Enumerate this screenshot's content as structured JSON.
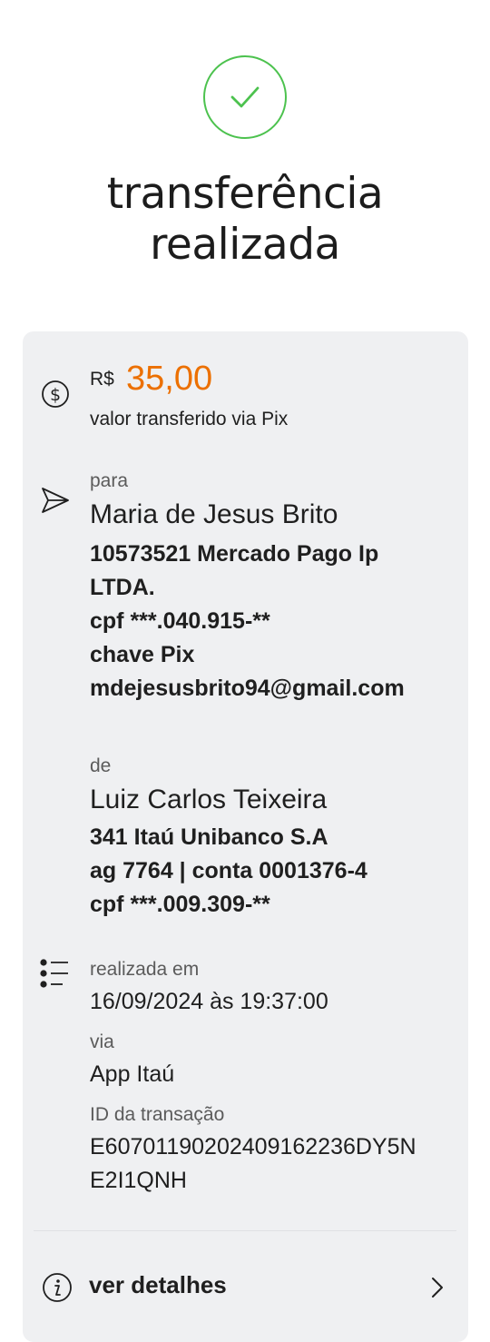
{
  "header": {
    "title_line1": "transferência",
    "title_line2": "realizada"
  },
  "amount": {
    "currency": "R$",
    "value": "35,00",
    "caption": "valor transferido via Pix"
  },
  "recipient": {
    "label": "para",
    "name": "Maria de Jesus Brito",
    "bank_line1": "10573521 Mercado Pago Ip",
    "bank_line2": "LTDA.",
    "cpf": "cpf ***.040.915-**",
    "key_label": "chave Pix",
    "key_value": "mdejesusbrito94@gmail.com"
  },
  "sender": {
    "label": "de",
    "name": "Luiz Carlos Teixeira",
    "bank": "341 Itaú Unibanco S.A",
    "account": "ag 7764 | conta 0001376-4",
    "cpf": "cpf ***.009.309-**"
  },
  "info": {
    "date_label": "realizada em",
    "date_value": "16/09/2024 às 19:37:00",
    "via_label": "via",
    "via_value": "App Itaú",
    "id_label": "ID da transação",
    "id_line1": "E60701190202409162236DY5N",
    "id_line2": "E2I1QNH"
  },
  "footer": {
    "details_label": "ver detalhes"
  },
  "colors": {
    "accent_orange": "#ec7000",
    "success_green": "#4cc24e",
    "card_bg": "#eff0f2"
  },
  "icons": {
    "status": "check-icon",
    "amount": "dollar-circle-icon",
    "recipient": "send-icon",
    "info": "list-icon",
    "details": "info-icon",
    "chevron": "chevron-right-icon"
  }
}
